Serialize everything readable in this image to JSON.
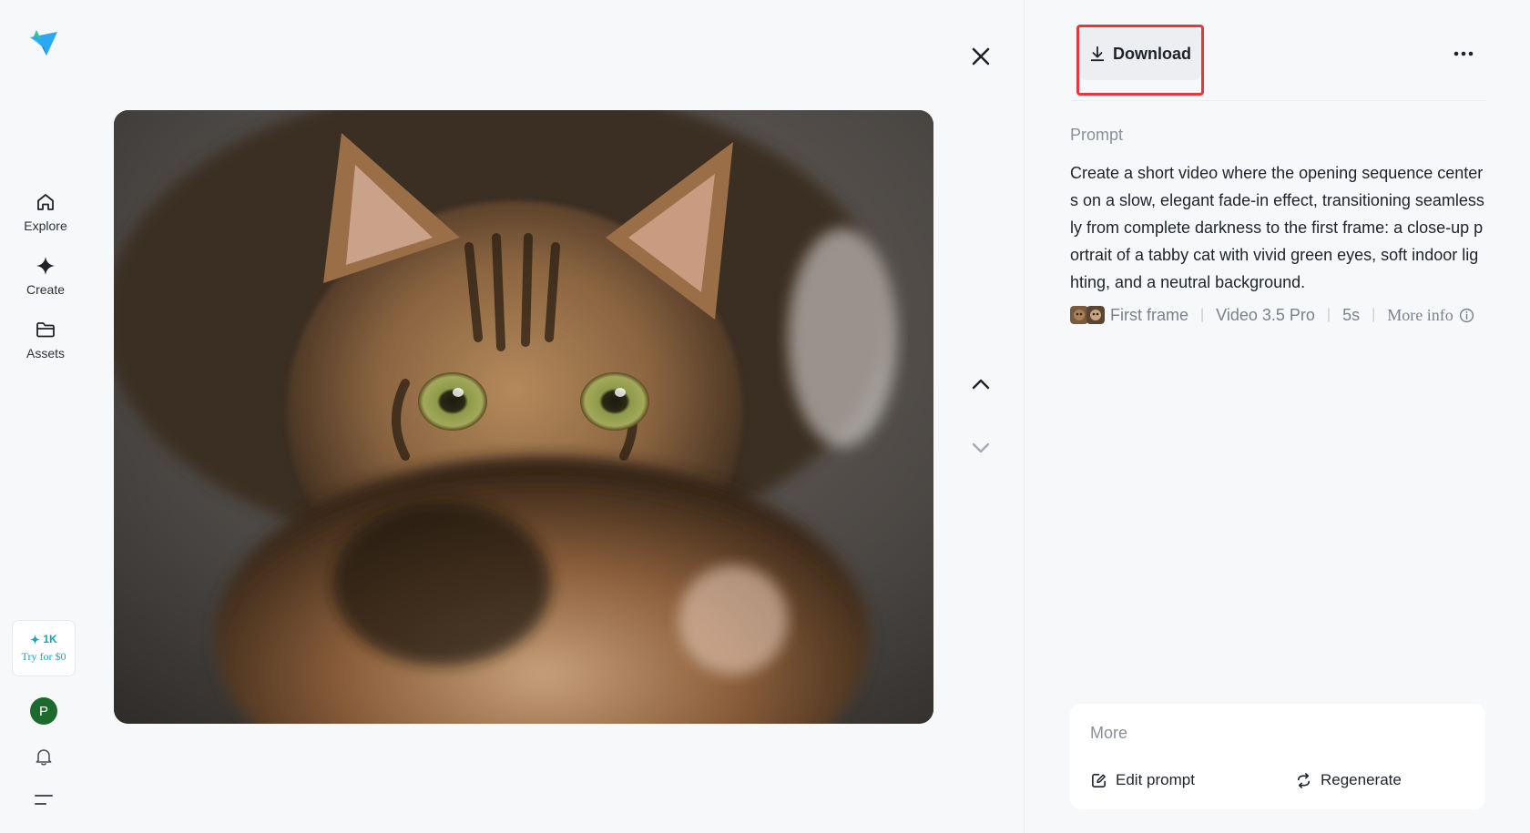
{
  "sidebar": {
    "items": [
      {
        "label": "Explore",
        "icon": "home-icon"
      },
      {
        "label": "Create",
        "icon": "sparkle-icon"
      },
      {
        "label": "Assets",
        "icon": "folder-icon"
      }
    ],
    "promo": {
      "credits": "1K",
      "cta": "Try for $0"
    },
    "avatar_initial": "P"
  },
  "header": {
    "download_label": "Download"
  },
  "details": {
    "prompt_label": "Prompt",
    "prompt_text": "Create a short video where the opening sequence centers on a slow, elegant fade-in effect, transitioning seamlessly from complete darkness to the first frame: a close-up portrait of a tabby cat with vivid green eyes, soft indoor lighting, and a neutral background.",
    "meta": {
      "first_frame": "First frame",
      "model": "Video 3.5 Pro",
      "duration": "5s",
      "more_info": "More info"
    }
  },
  "more": {
    "title": "More",
    "actions": [
      {
        "label": "Edit prompt",
        "icon": "edit-icon"
      },
      {
        "label": "Regenerate",
        "icon": "regenerate-icon"
      }
    ]
  },
  "colors": {
    "accent": "#1aa3b8",
    "highlight": "#e0393e",
    "avatar": "#1d6b2c"
  }
}
